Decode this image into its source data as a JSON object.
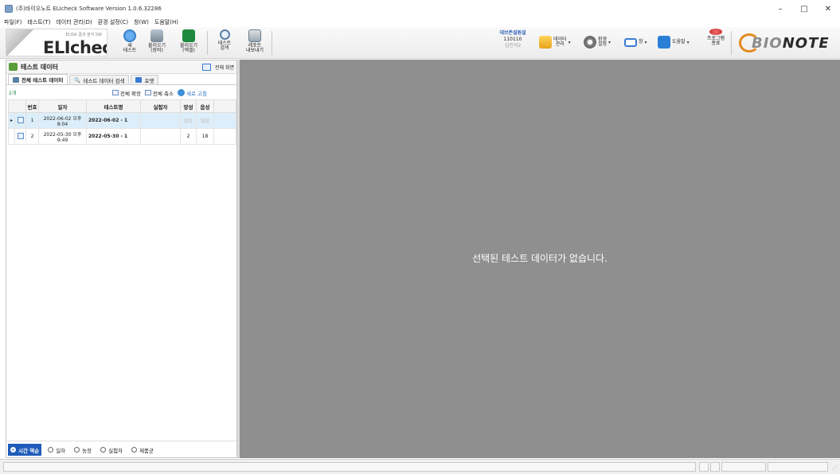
{
  "window": {
    "title": "(주)바이오노트 ELIcheck Software Version 1.0.6.32286",
    "controls": [
      "–",
      "□",
      "✕"
    ]
  },
  "menu": [
    "파일(F)",
    "테스트(T)",
    "데이터 관리(D)",
    "환경 설정(C)",
    "창(W)",
    "도움말(H)"
  ],
  "logo": {
    "subtitle": "ELISA 결과 분석 SW",
    "name": "ELIcheck"
  },
  "toolbar": {
    "new_test": "새\n테스트",
    "import_device": "불러오기\n(장비)",
    "import_excel": "불러오기\n(엑셀)",
    "test_search": "테스트\n검색",
    "report_export": "레포트\n내보내기"
  },
  "lab": {
    "line1": "대브존설원설",
    "line2": "110110",
    "line3": "김민석2"
  },
  "right_toolbar": {
    "data_manage": "데이터\n관리",
    "settings": "환경\n설정",
    "window": "창",
    "help": "도움말",
    "exit": "프로그램\n종료"
  },
  "brand": {
    "bio": "BIO",
    "note": "NOTE"
  },
  "panel": {
    "title": "테스트 데이터",
    "fullscreen": "전체 화면",
    "tabs": [
      "전체 테스트 데이터",
      "테스트 데이터 검색",
      "포맷"
    ],
    "count": "2개",
    "expand_all": "전체 확장",
    "collapse_all": "전체 축소",
    "refresh": "새로 고침"
  },
  "table": {
    "headers": [
      "번호",
      "일자",
      "테스트명",
      "실험자",
      "양성",
      "음성"
    ],
    "rows": [
      {
        "no": "1",
        "date": "2022-06-02 오후 8:04",
        "name": "2022-06-02 - 1",
        "tester": "",
        "pos": "없음",
        "neg": "없음"
      },
      {
        "no": "2",
        "date": "2022-05-30 오후 9:49",
        "name": "2022-05-30 - 1",
        "tester": "",
        "pos": "2",
        "neg": "18"
      }
    ]
  },
  "sort": [
    "시간 역순",
    "일자",
    "농장",
    "실험자",
    "제품군"
  ],
  "main": {
    "empty_message": "선택된 테스트 데이터가 없습니다."
  },
  "colors": {
    "accent": "#1e5bb8",
    "canvas": "#8f8f8f",
    "brand_orange": "#e58a1f"
  }
}
